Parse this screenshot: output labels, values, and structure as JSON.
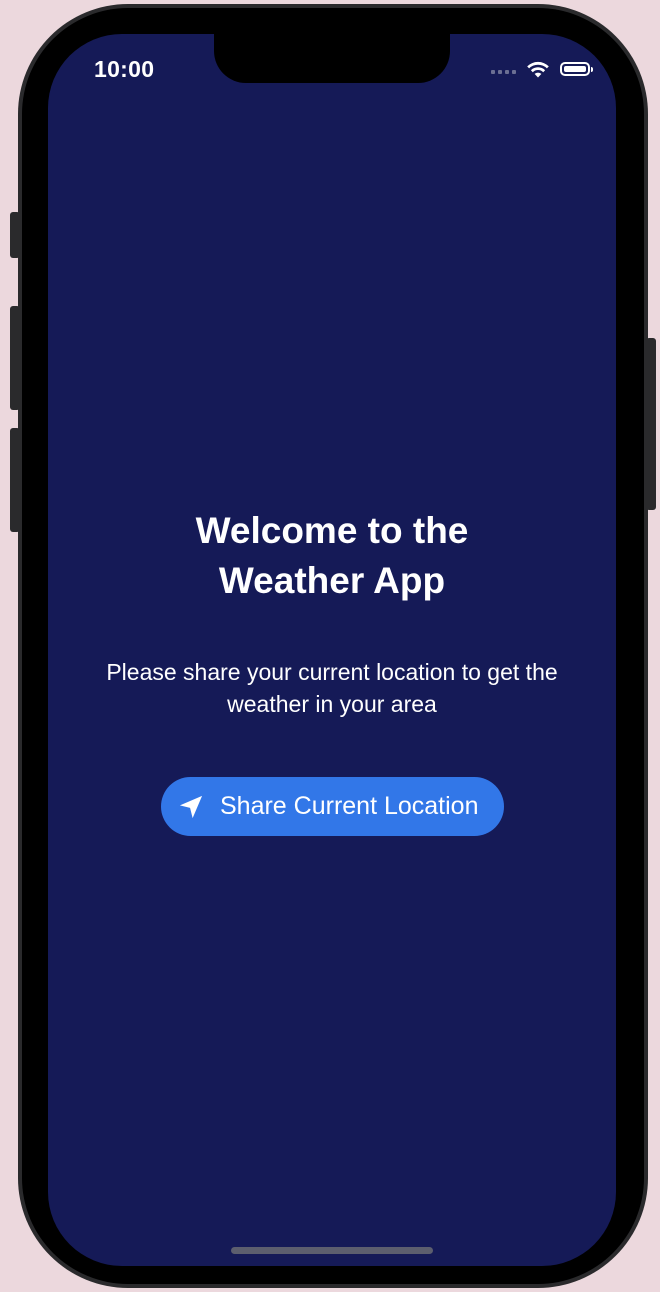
{
  "status_bar": {
    "time": "10:00"
  },
  "welcome": {
    "title": "Welcome to the\nWeather App",
    "subtitle": "Please share your current location to get the weather in your area"
  },
  "share_button": {
    "label": "Share Current Location",
    "icon": "location-arrow-icon"
  },
  "colors": {
    "background": "#151a57",
    "button": "#3277e8",
    "text": "#ffffff"
  }
}
